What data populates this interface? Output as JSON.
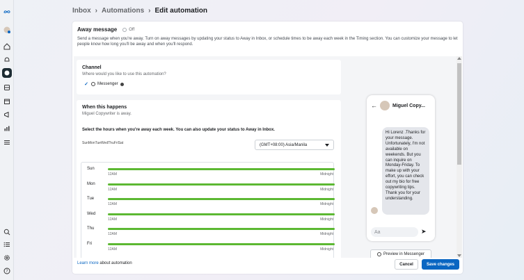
{
  "breadcrumb": {
    "inbox": "Inbox",
    "automations": "Automations",
    "current": "Edit automation",
    "sep": "›"
  },
  "away": {
    "title": "Away message",
    "toggle_state": "Off",
    "description": "Send a message when you're away. Turn on away messages by updating your status to Away in Inbox, or schedule times to be away each week in the Timing section. You can customize your message to let people know how long you'll be away and when you'll respond."
  },
  "channel": {
    "title": "Channel",
    "question": "Where would you like to use this automation?",
    "option": "Messenger",
    "checked": true
  },
  "when": {
    "title": "When this happens",
    "status": "Miguel Copywriter is away.",
    "instruction": "Select the hours when you're away each week. You can also update your status to Away in Inbox.",
    "days_line": "SunMonTueWedThuFriSat",
    "timezone": "(GMT+08:00) Asia/Manila"
  },
  "schedule": [
    {
      "day": "Sun",
      "start": "12AM",
      "end": "Midnight"
    },
    {
      "day": "Mon",
      "start": "12AM",
      "end": "Midnight"
    },
    {
      "day": "Tue",
      "start": "12AM",
      "end": "Midnight"
    },
    {
      "day": "Wed",
      "start": "12AM",
      "end": "Midnight"
    },
    {
      "day": "Thu",
      "start": "12AM",
      "end": "Midnight"
    },
    {
      "day": "Fri",
      "start": "12AM",
      "end": "Midnight"
    }
  ],
  "preview": {
    "name": "Miguel Copy...",
    "message": "Hi Lorenz .Thanks for your message. Unfortunately, I'm not available on weekends. But you can inquire on Monday-Friday. To make up with your effort, you can check out my bio for free copywriting tips. Thank you for your understanding.",
    "input_placeholder": "Aa",
    "button": "Preview in Messenger"
  },
  "footer": {
    "learn_more": "Learn more",
    "about": " about automation"
  },
  "actions": {
    "cancel": "Cancel",
    "save": "Save changes"
  },
  "colors": {
    "accent": "#0a66c2",
    "schedule_bar": "#5cb832"
  },
  "icons": [
    "meta-logo-icon",
    "profile-icon",
    "home-icon",
    "notifications-icon",
    "inbox-icon",
    "content-icon",
    "planner-icon",
    "ads-icon",
    "insights-icon",
    "menu-icon",
    "search-icon",
    "list-icon",
    "settings-icon",
    "help-icon"
  ]
}
